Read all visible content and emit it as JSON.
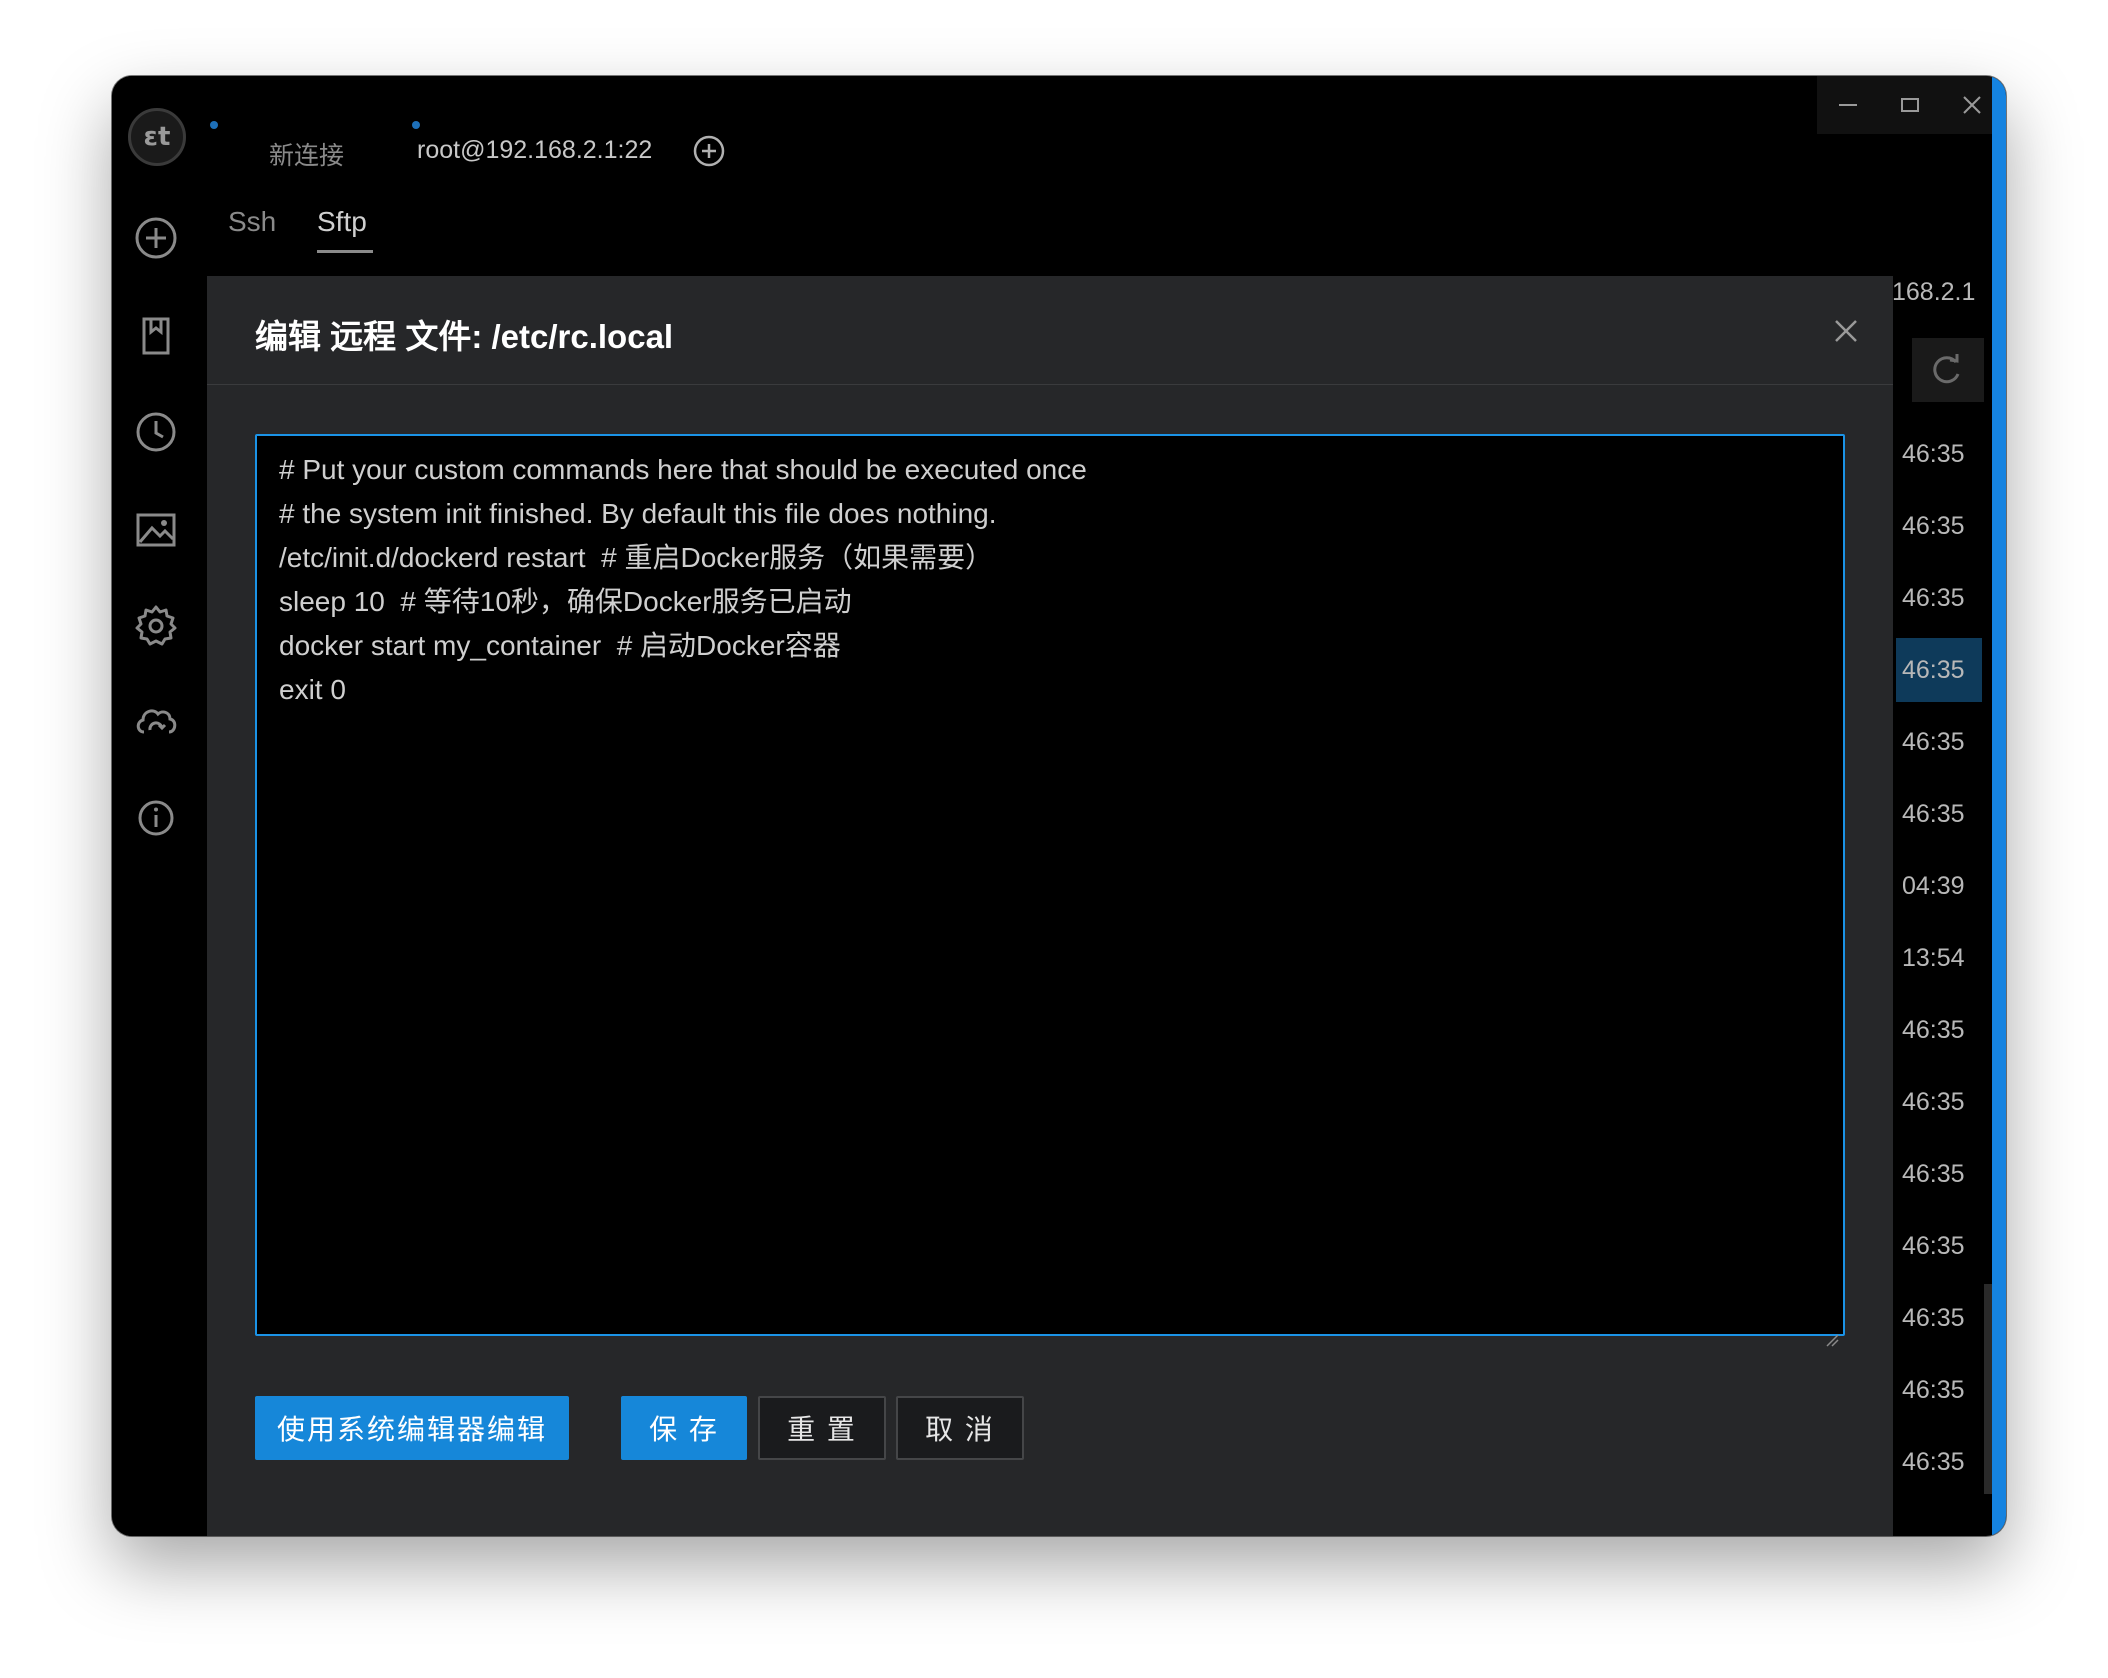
{
  "app": {
    "logo_text": "εt"
  },
  "sidebar": {
    "items": [
      {
        "icon": "plus-circle-icon"
      },
      {
        "icon": "bookmark-icon"
      },
      {
        "icon": "clock-icon"
      },
      {
        "icon": "image-icon"
      },
      {
        "icon": "gear-icon"
      },
      {
        "icon": "cloud-sync-icon"
      },
      {
        "icon": "info-icon"
      }
    ]
  },
  "tabs": [
    {
      "label": "新连接",
      "active": false
    },
    {
      "label": "root@192.168.2.1:22",
      "active": true
    }
  ],
  "subtabs": [
    {
      "label": "Ssh",
      "active": false
    },
    {
      "label": "Sftp",
      "active": true
    }
  ],
  "background": {
    "host_fragment": "168.2.1",
    "times": [
      "46:35",
      "46:35",
      "46:35",
      "46:35",
      "46:35",
      "46:35",
      "04:39",
      "13:54",
      "46:35",
      "46:35",
      "46:35",
      "46:35",
      "46:35",
      "46:35",
      "46:35"
    ],
    "selected_index": 3
  },
  "dialog": {
    "title": "编辑 远程 文件: /etc/rc.local",
    "content_lines": [
      "# Put your custom commands here that should be executed once",
      "# the system init finished. By default this file does nothing.",
      "/etc/init.d/dockerd restart  # 重启Docker服务（如果需要）",
      "sleep 10  # 等待10秒，确保Docker服务已启动",
      "docker start my_container  # 启动Docker容器",
      "exit 0"
    ],
    "buttons": {
      "system_editor": "使用系统编辑器编辑",
      "save": "保 存",
      "reset": "重 置",
      "cancel": "取 消"
    }
  },
  "colors": {
    "accent": "#1687d9",
    "editor_border": "#1b93e6",
    "dialog_bg": "#262729",
    "window_bg": "#000000"
  }
}
